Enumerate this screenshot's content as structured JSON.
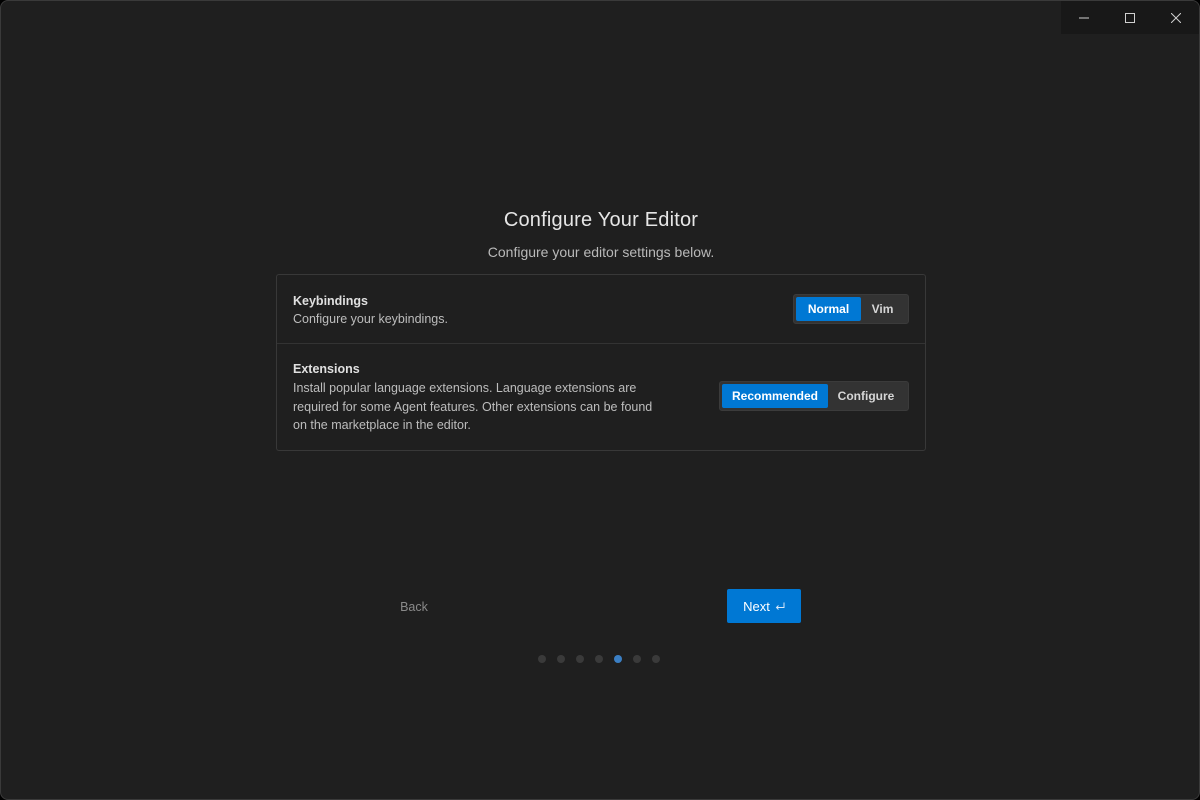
{
  "window_controls": {
    "minimize_icon": "minimize-icon",
    "maximize_icon": "maximize-icon",
    "close_icon": "close-icon"
  },
  "header": {
    "title": "Configure Your Editor",
    "subtitle": "Configure your editor settings below."
  },
  "settings": {
    "keybindings": {
      "title": "Keybindings",
      "description": "Configure your keybindings.",
      "options": [
        "Normal",
        "Vim"
      ],
      "selected": "Normal"
    },
    "extensions": {
      "title": "Extensions",
      "description": "Install popular language extensions. Language extensions are required for some Agent features. Other extensions can be found on the marketplace in the editor.",
      "options": [
        "Recommended",
        "Configure"
      ],
      "selected": "Recommended"
    }
  },
  "footer": {
    "back_label": "Back",
    "next_label": "Next",
    "next_icon": "enter-key-icon"
  },
  "progress": {
    "total_steps": 7,
    "current_step": 5
  },
  "colors": {
    "accent": "#0078d4",
    "background": "#1f1f1f",
    "active_dot": "#3b7fc4"
  }
}
